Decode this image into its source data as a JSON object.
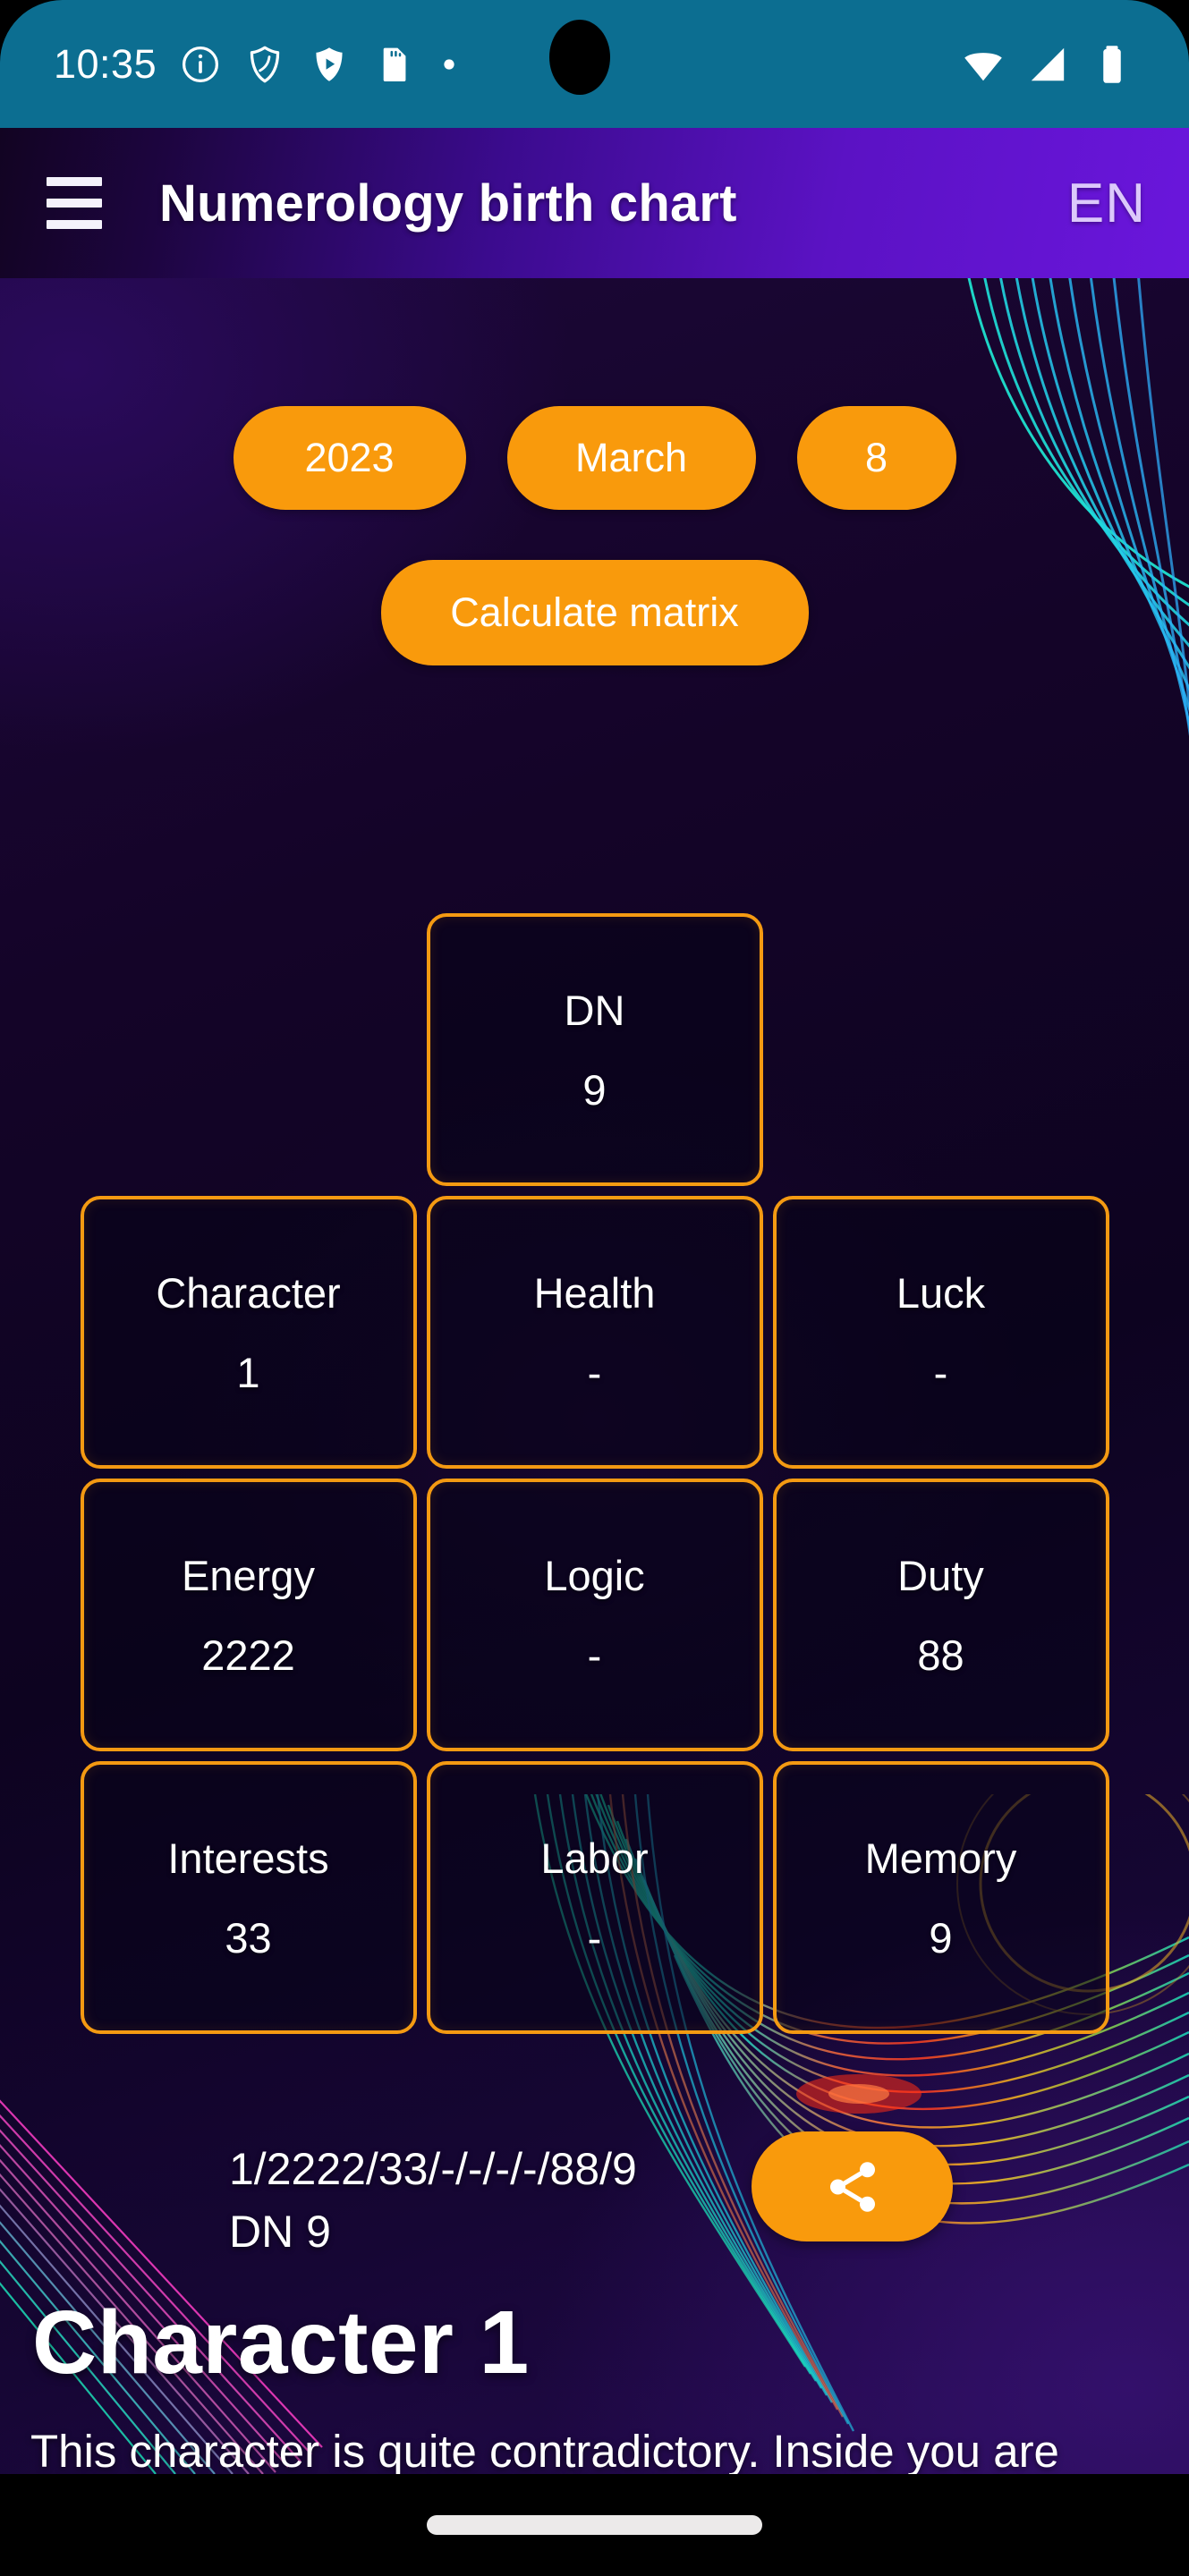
{
  "status_bar": {
    "time": "10:35",
    "left_icons": [
      "info-circle-icon",
      "shield-outline-icon",
      "shield-play-icon",
      "sd-card-icon",
      "dot-icon"
    ],
    "right_icons": [
      "wifi-icon",
      "cellular-signal-icon",
      "battery-icon"
    ],
    "background_color": "#0c6e91"
  },
  "app_bar": {
    "menu_icon": "hamburger-menu-icon",
    "title": "Numerology birth chart",
    "language": "EN",
    "gradient_from": "#120422",
    "gradient_to": "#6a16dc"
  },
  "date_selector": {
    "year": "2023",
    "month": "March",
    "day": "8",
    "calculate_label": "Calculate matrix",
    "accent_color": "#f99a0c"
  },
  "matrix": {
    "border_color": "#f49a12",
    "top_cell": {
      "label": "DN",
      "value": "9"
    },
    "rows": [
      [
        {
          "label": "Character",
          "value": "1"
        },
        {
          "label": "Health",
          "value": "-"
        },
        {
          "label": "Luck",
          "value": "-"
        }
      ],
      [
        {
          "label": "Energy",
          "value": "2222"
        },
        {
          "label": "Logic",
          "value": "-"
        },
        {
          "label": "Duty",
          "value": "88"
        }
      ],
      [
        {
          "label": "Interests",
          "value": "33"
        },
        {
          "label": "Labor",
          "value": "-"
        },
        {
          "label": "Memory",
          "value": "9"
        }
      ]
    ]
  },
  "result": {
    "formula": "1/2222/33/-/-/-/-/88/9",
    "dn_line": "DN 9",
    "share_icon": "share-icon",
    "title": "Character 1",
    "description": "This character is quite contradictory. Inside you are"
  },
  "nav_bar": {
    "handle": "home-gesture-handle"
  }
}
